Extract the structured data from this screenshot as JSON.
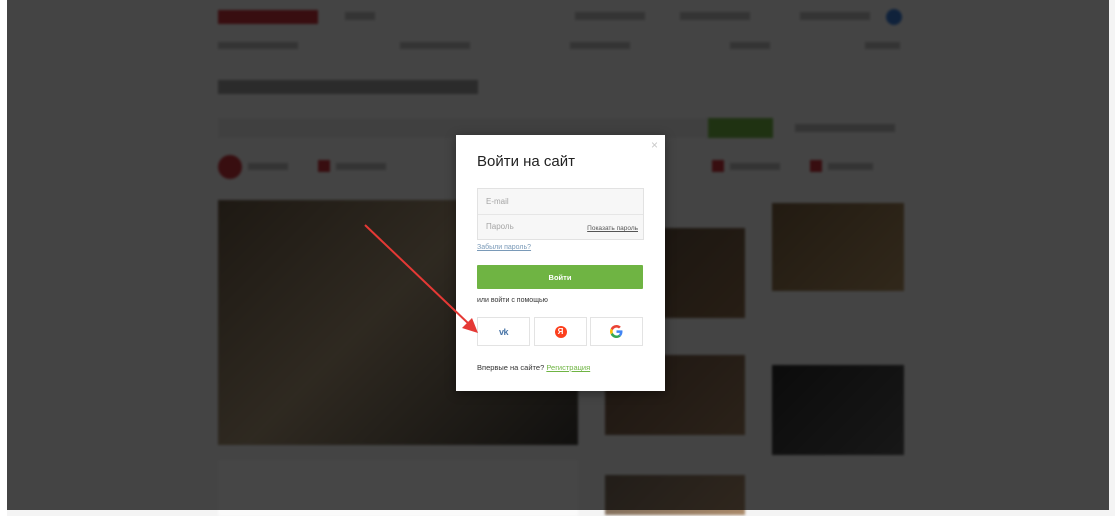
{
  "modal": {
    "title": "Войти на сайт",
    "close": "×",
    "email_placeholder": "E-mail",
    "password_placeholder": "Пароль",
    "show_password": "Показать пароль",
    "forgot": "Забыли пароль?",
    "login_button": "Войти",
    "alt_login": "или войти с помощью",
    "social": {
      "vk": "vk",
      "yandex": "Я",
      "google": "G"
    },
    "register_prompt": "Впервые на сайте?",
    "register_link": "Регистрация"
  },
  "colors": {
    "primary_green": "#6fb443",
    "vk_blue": "#4a76a8",
    "yandex_red": "#fc3f1d",
    "arrow_red": "#e53935"
  }
}
